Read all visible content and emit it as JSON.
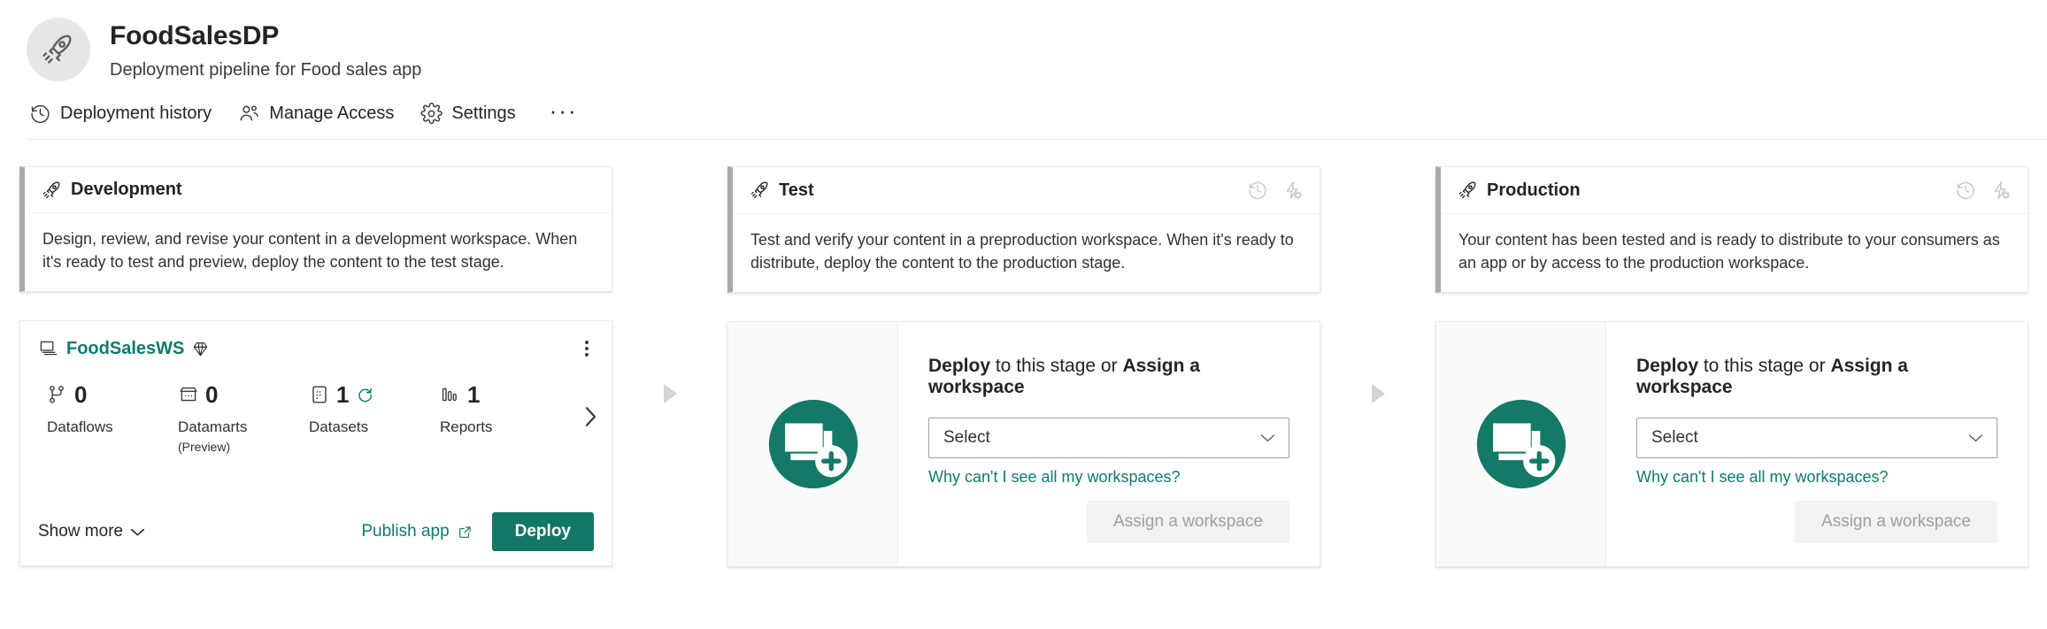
{
  "header": {
    "avatar_icon": "rocket-icon",
    "title": "FoodSalesDP",
    "subtitle": "Deployment pipeline for Food sales app"
  },
  "commandbar": {
    "items": [
      {
        "label": "Deployment history",
        "icon": "history-icon"
      },
      {
        "label": "Manage Access",
        "icon": "people-icon"
      },
      {
        "label": "Settings",
        "icon": "gear-icon"
      }
    ],
    "overflow_label": "···"
  },
  "stages": [
    {
      "name": "Development",
      "icon": "rocket-icon",
      "description": "Design, review, and revise your content in a development workspace. When it's ready to test and preview, deploy the content to the test stage.",
      "has_header_actions": false
    },
    {
      "name": "Test",
      "icon": "rocket-icon",
      "description": "Test and verify your content in a preproduction workspace. When it's ready to distribute, deploy the content to the production stage.",
      "has_header_actions": true
    },
    {
      "name": "Production",
      "icon": "rocket-icon",
      "description": "Your content has been tested and is ready to distribute to your consumers as an app or by access to the production workspace.",
      "has_header_actions": true
    }
  ],
  "header_actions": {
    "history_icon": "deployment-history-icon",
    "rules_icon": "deployment-rules-icon"
  },
  "workspace": {
    "icon": "workspace-icon",
    "name": "FoodSalesWS",
    "badge_icon": "premium-diamond-icon",
    "menu_icon": "more-options-icon",
    "metrics": [
      {
        "icon": "dataflow-icon",
        "value": "0",
        "label": "Dataflows",
        "sublabel": "",
        "refresh": false
      },
      {
        "icon": "datamart-icon",
        "value": "0",
        "label": "Datamarts",
        "sublabel": "(Preview)",
        "refresh": false
      },
      {
        "icon": "dataset-icon",
        "value": "1",
        "label": "Datasets",
        "sublabel": "",
        "refresh": true
      },
      {
        "icon": "report-icon",
        "value": "1",
        "label": "Reports",
        "sublabel": "",
        "refresh": false
      }
    ],
    "next_icon": "chevron-right-icon",
    "show_more_label": "Show more",
    "show_more_icon": "chevron-down-icon",
    "publish_app_label": "Publish app",
    "publish_app_icon": "external-link-icon",
    "deploy_label": "Deploy"
  },
  "empty_stage": {
    "illustration_icon": "add-workspace-illustration",
    "title_lead": "Deploy",
    "title_mid": " to this stage or ",
    "title_tail": "Assign a workspace",
    "select_value": "Select",
    "select_icon": "chevron-down-icon",
    "help_link": "Why can't I see all my workspaces?",
    "assign_label": "Assign a workspace"
  },
  "arrow_icon": "stage-arrow-icon",
  "colors": {
    "accent_teal": "#117865",
    "link_teal": "#0d7b6b",
    "stage_bar": "#a9a9a9",
    "arrow": "#d4d4d4",
    "disabled_text": "#a19f9d"
  }
}
